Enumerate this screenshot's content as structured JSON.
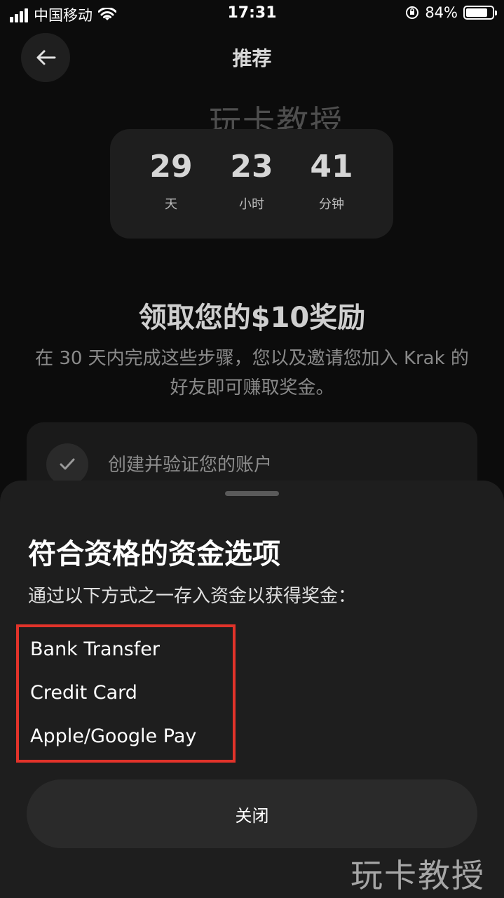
{
  "status_bar": {
    "carrier": "中国移动",
    "time": "17:31",
    "battery": "84%",
    "battery_level": 0.84
  },
  "header": {
    "title": "推荐"
  },
  "watermark": "玩卡教授",
  "countdown": [
    {
      "value": "29",
      "label": "天"
    },
    {
      "value": "23",
      "label": "小时"
    },
    {
      "value": "41",
      "label": "分钟"
    }
  ],
  "reward": {
    "title": "领取您的$10奖励",
    "description": "在 30 天内完成这些步骤，您以及邀请您加入 Krak 的好友即可赚取奖金。"
  },
  "steps": [
    {
      "label": "创建并验证您的账户",
      "icon": "check-icon"
    }
  ],
  "sheet": {
    "title": "符合资格的资金选项",
    "subtitle": "通过以下方式之一存入资金以获得奖金：",
    "options": [
      "Bank Transfer",
      "Credit Card",
      "Apple/Google Pay"
    ],
    "close_label": "关闭",
    "highlight_color": "#e2332a"
  }
}
